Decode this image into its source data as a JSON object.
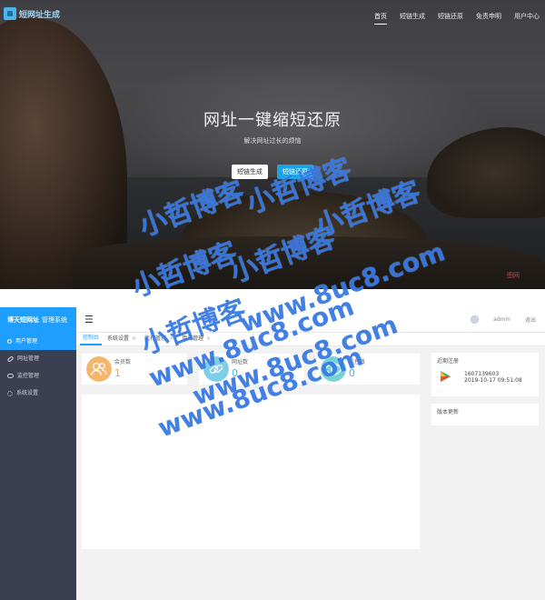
{
  "hero": {
    "logo_text": "短网址生成",
    "menu": [
      {
        "label": "首页",
        "active": true
      },
      {
        "label": "短链生成",
        "active": false
      },
      {
        "label": "短链还原",
        "active": false
      },
      {
        "label": "免责申明",
        "active": false
      },
      {
        "label": "用户中心",
        "active": false
      }
    ],
    "title": "网址一键缩短还原",
    "subtitle": "解决网址过长的烦恼",
    "btn_generate": "短链生成",
    "btn_restore": "短链还原",
    "corner_mark": "图网"
  },
  "admin": {
    "brand": "博天短网址",
    "brand_sub": "管理系统",
    "sidebar": [
      {
        "label": "用户管理",
        "icon": "user-icon",
        "active": true
      },
      {
        "label": "网址管理",
        "icon": "link-icon",
        "active": false
      },
      {
        "label": "监控管理",
        "icon": "eye-icon",
        "active": false
      },
      {
        "label": "系统设置",
        "icon": "gear-icon",
        "active": false
      }
    ],
    "topbar": {
      "user": "admin",
      "logout": "退出"
    },
    "tabs": [
      {
        "label": "控制台",
        "active": true,
        "closable": false
      },
      {
        "label": "系统设置",
        "active": false,
        "closable": true
      },
      {
        "label": "监控管理",
        "active": false,
        "closable": true
      },
      {
        "label": "用户管理",
        "active": false,
        "closable": true
      }
    ],
    "cards": [
      {
        "label": "会员数",
        "value": "1",
        "color": "#f5b66b",
        "value_color": "#f5a623",
        "icon": "users-icon"
      },
      {
        "label": "网址数",
        "value": "0",
        "color": "#7dcfe8",
        "value_color": "#4db6e0",
        "icon": "link-icon"
      },
      {
        "label": "监控数",
        "value": "0",
        "color": "#76d3d2",
        "value_color": "#4db6e0",
        "icon": "eye-icon"
      }
    ],
    "recent": {
      "title": "近期注册",
      "user": "1607139603",
      "date": "2019-10-17 09:51:08"
    },
    "updates_title": "版本更新"
  },
  "watermark": {
    "site": "小哲博客",
    "url": "www.8uc8.com"
  }
}
